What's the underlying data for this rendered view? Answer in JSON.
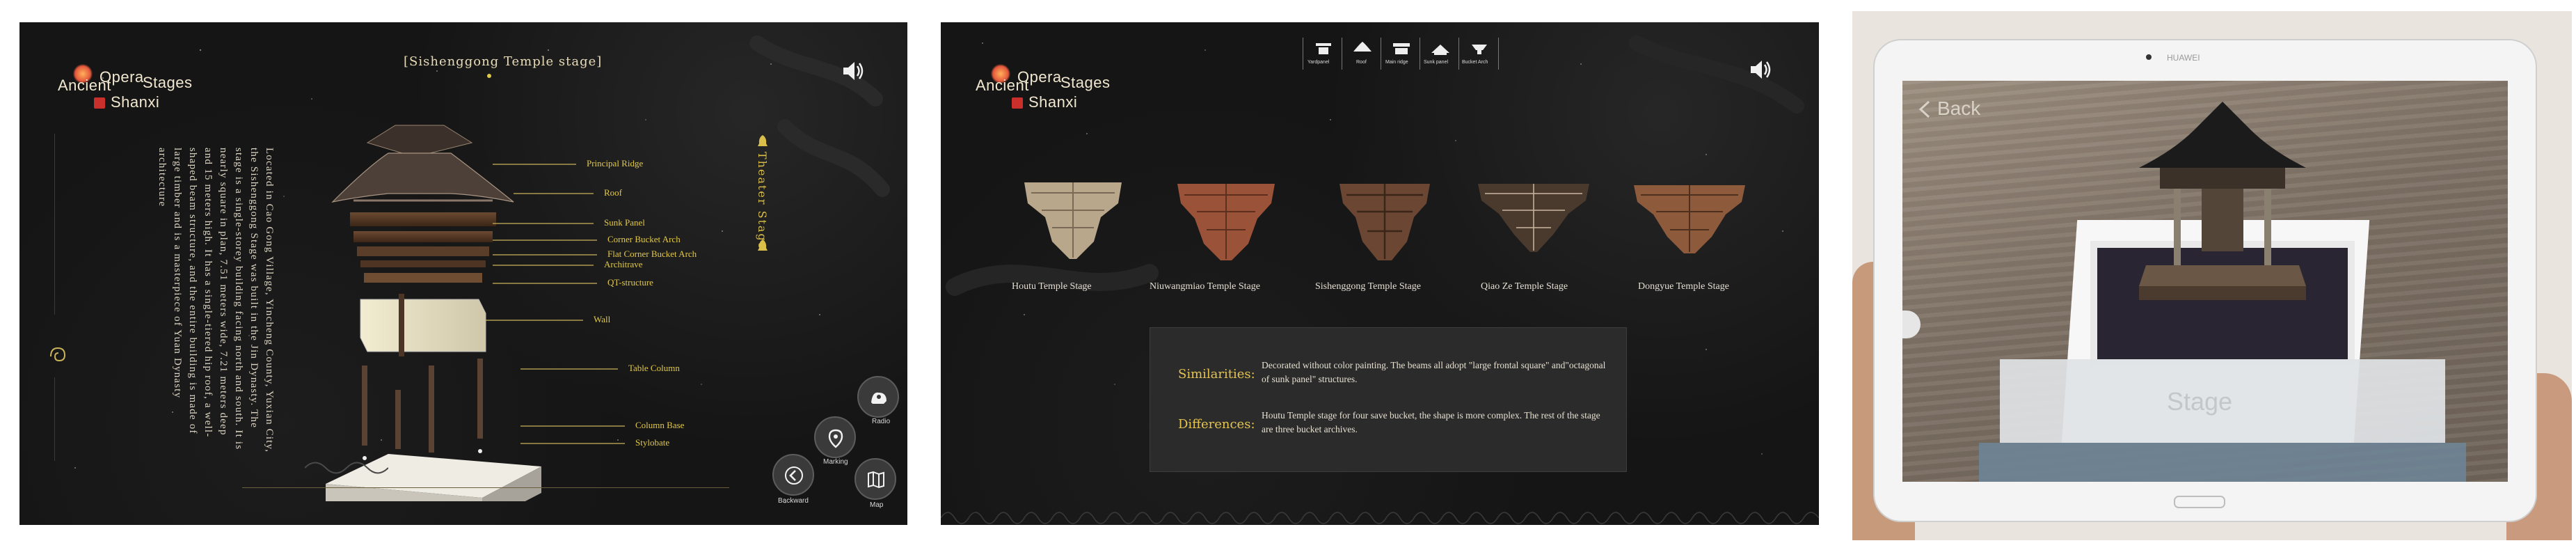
{
  "panel1": {
    "brand": {
      "word1": "Ancient",
      "word2": "Opera",
      "word3": "Stages",
      "word4": "Shanxi"
    },
    "title": "[Sishenggong Temple stage]",
    "labels": {
      "principal_ridge": "Principal Ridge",
      "roof": "Roof",
      "sunk_panel": "Sunk Panel",
      "corner_bucket_arch": "Corner Bucket Arch",
      "flat_corner_bucket_arch": "Flat Corner Bucket Arch",
      "architrave": "Architrave",
      "qt_structure": "QT-structure",
      "wall": "Wall",
      "table_column": "Table Column",
      "column_base": "Column Base",
      "stylobate": "Stylobate"
    },
    "description": "Located in Cao Gong Village, Yincheng County, Yuxian City, the Sishenggong Stage was built in the Jin Dynasty. The stage is a single-storey building facing north and south. It is nearly square in plan, 7.51 meters wide, 7.21 meters deep and 15 meters high. It has a single-tiered hip roof, a well-shaped beam structure, and the entire building is made of large timber and is a masterpiece of Yuan Dynasty architecture",
    "vertical_label": "Theater Stage",
    "buttons": {
      "radio": "Radio",
      "marking": "Marking",
      "backward": "Backward",
      "map": "Map"
    }
  },
  "panel2": {
    "brand": {
      "word1": "Ancient",
      "word2": "Opera",
      "word3": "Stages",
      "word4": "Shanxi"
    },
    "toolbar": [
      "Yardpanel",
      "Roof",
      "Main ridge",
      "Sunk panel",
      "Bucket Arch"
    ],
    "stages": [
      "Houtu Temple Stage",
      "Niuwangmiao Temple Stage",
      "Sishenggong Temple Stage",
      "Qiao Ze Temple Stage",
      "Dongyue Temple Stage"
    ],
    "similarities_label": "Similarities:",
    "similarities_text": "Decorated without color painting. The beams all adopt \"large frontal square\" and\"octagonal of sunk panel\" structures.",
    "differences_label": "Differences:",
    "differences_text": "Houtu Temple stage for four save bucket, the shape is more complex. The rest of the stage are three bucket archives."
  },
  "panel3": {
    "brand_text": "HUAWEI",
    "back_label": "Back",
    "stage_label": "Stage"
  },
  "colors": {
    "gold": "#e1c84b",
    "dark_bg": "#151515",
    "panel_box": "#2b2b2b",
    "accent_red": "#c9302c"
  }
}
